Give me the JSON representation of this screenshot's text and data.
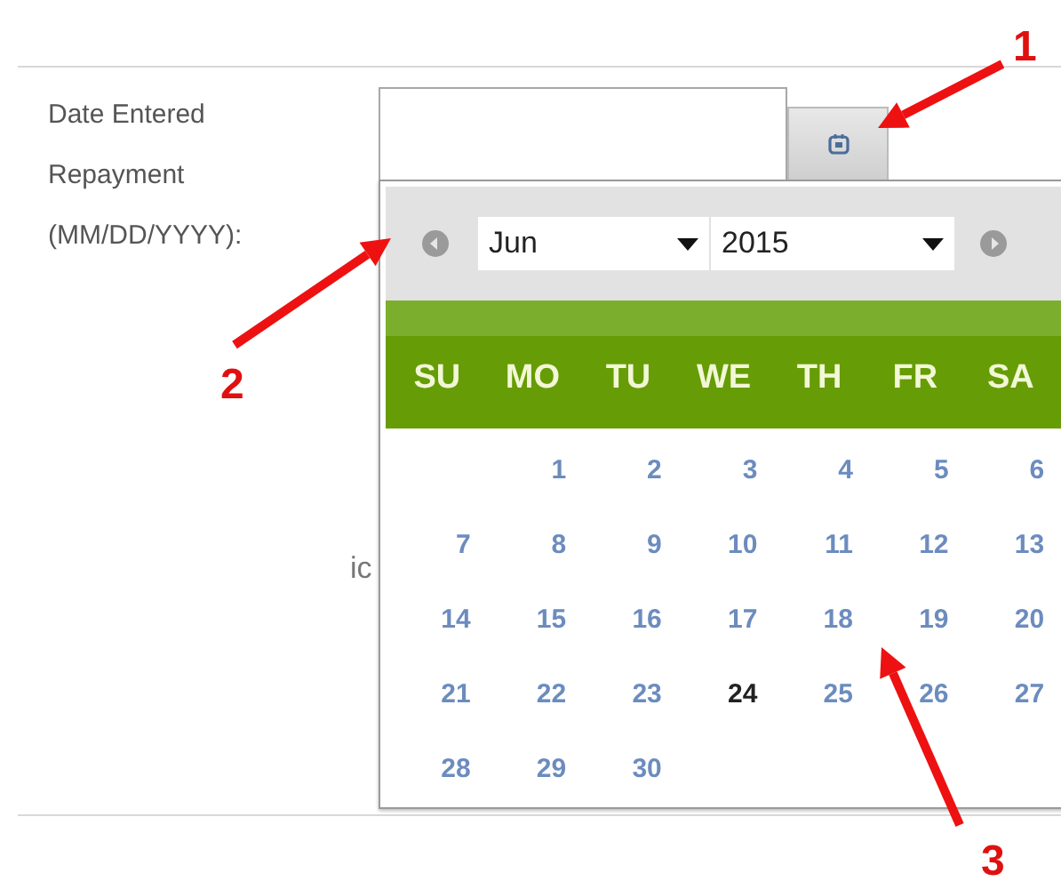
{
  "form": {
    "label": "Date Entered Repayment (MM/DD/YYYY):",
    "date_field": {
      "kind": "empty"
    },
    "hidden_label": "ic"
  },
  "datepicker": {
    "month": "Jun",
    "year": "2015",
    "weekdays": [
      "SU",
      "MO",
      "TU",
      "WE",
      "TH",
      "FR",
      "SA"
    ],
    "weeks": [
      [
        {
          "day": "1",
          "today": false
        },
        {
          "day": "2",
          "today": false
        },
        {
          "day": "3",
          "today": false
        },
        {
          "day": "4",
          "today": false
        },
        {
          "day": "5",
          "today": false
        },
        {
          "day": "6",
          "today": false
        }
      ],
      [
        {
          "day": "7",
          "today": false
        },
        {
          "day": "8",
          "today": false
        },
        {
          "day": "9",
          "today": false
        },
        {
          "day": "10",
          "today": false
        },
        {
          "day": "11",
          "today": false
        },
        {
          "day": "12",
          "today": false
        },
        {
          "day": "13",
          "today": false
        }
      ],
      [
        {
          "day": "14",
          "today": false
        },
        {
          "day": "15",
          "today": false
        },
        {
          "day": "16",
          "today": false
        },
        {
          "day": "17",
          "today": false
        },
        {
          "day": "18",
          "today": false
        },
        {
          "day": "19",
          "today": false
        },
        {
          "day": "20",
          "today": false
        }
      ],
      [
        {
          "day": "21",
          "today": false
        },
        {
          "day": "22",
          "today": false
        },
        {
          "day": "23",
          "today": false
        },
        {
          "day": "24",
          "today": true
        },
        {
          "day": "25",
          "today": false
        },
        {
          "day": "26",
          "today": false
        },
        {
          "day": "27",
          "today": false
        }
      ],
      [
        {
          "day": "28",
          "today": false
        },
        {
          "day": "29",
          "today": false
        },
        {
          "day": "30",
          "today": false
        }
      ]
    ]
  },
  "annotations": [
    {
      "label": "1"
    },
    {
      "label": "2"
    },
    {
      "label": "3"
    }
  ]
}
